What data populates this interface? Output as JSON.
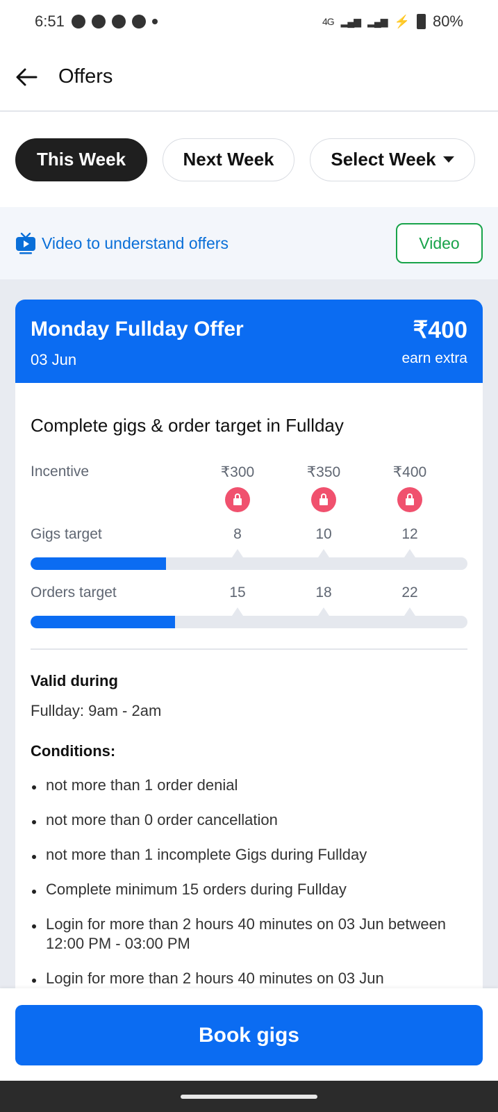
{
  "status_bar": {
    "time": "6:51",
    "network": "4G",
    "battery": "80%",
    "icons": [
      "snapchat-icon",
      "snapchat-icon",
      "chat-icon",
      "chat-icon",
      "dot-icon",
      "signal-icon",
      "wifi-icon",
      "battery-icon"
    ]
  },
  "header": {
    "title": "Offers"
  },
  "week_tabs": [
    {
      "label": "This Week",
      "active": true
    },
    {
      "label": "Next Week",
      "active": false
    },
    {
      "label": "Select Week",
      "active": false
    }
  ],
  "video_bar": {
    "link_label": "Video to understand offers",
    "button_label": "Video"
  },
  "offer": {
    "title": "Monday Fullday Offer",
    "date": "03 Jun",
    "amount": "₹400",
    "amount_caption": "earn extra",
    "target_heading": "Complete gigs & order target in Fullday",
    "incentive_label": "Incentive",
    "incentives": [
      "₹300",
      "₹350",
      "₹400"
    ],
    "gigs_label": "Gigs target",
    "gigs_targets": [
      "8",
      "10",
      "12"
    ],
    "gigs_progress": 0.31,
    "orders_label": "Orders target",
    "orders_targets": [
      "15",
      "18",
      "22"
    ],
    "orders_progress": 0.33,
    "valid_heading": "Valid during",
    "valid_text": "Fullday: 9am - 2am",
    "conditions_heading": "Conditions:",
    "conditions": [
      "not more than 1 order denial",
      "not more than 0 order cancellation",
      "not more than 1 incomplete Gigs during Fullday",
      "Complete minimum 15 orders during Fullday",
      "Login for more than 2 hours 40 minutes on 03 Jun between 12:00 PM - 03:00 PM",
      "Login for more than 2 hours 40 minutes on 03 Jun"
    ]
  },
  "footer": {
    "book_label": "Book gigs"
  },
  "colors": {
    "primary": "#0b6cf2",
    "link": "#0a6fd8",
    "video_green": "#18a34a",
    "lock_red": "#f0516e",
    "active_tab": "#1f1f1f"
  }
}
